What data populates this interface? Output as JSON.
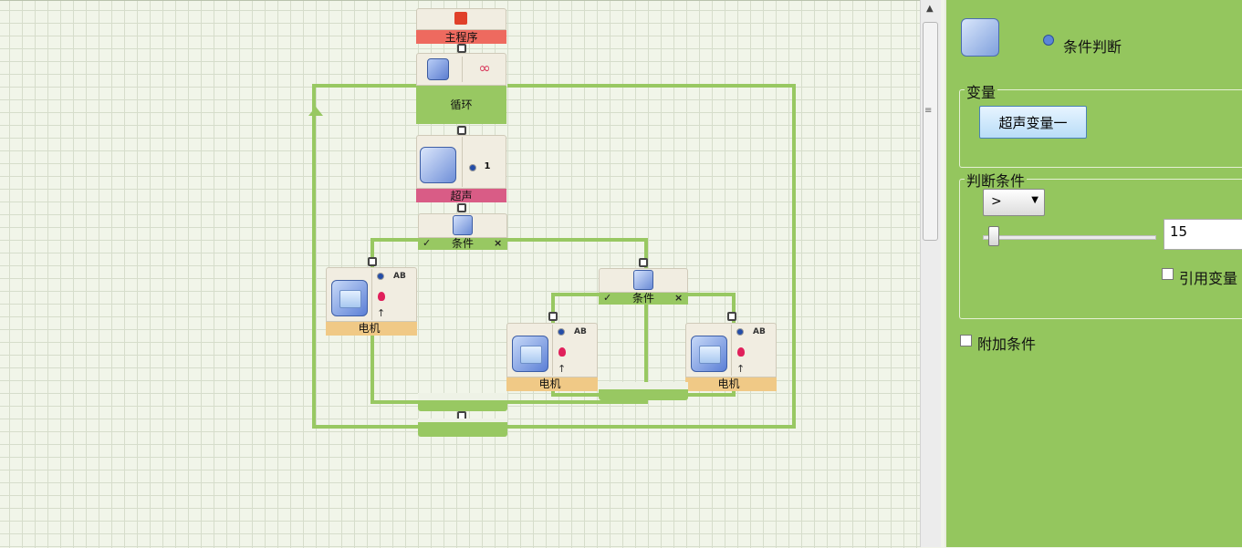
{
  "flow": {
    "main_program": "主程序",
    "loop": "循环",
    "loop_count_symbol": "∞",
    "ultrasonic": "超声",
    "ultrasonic_port": "1",
    "condition_1": "条件",
    "condition_2": "条件",
    "check_mark": "✓",
    "cross_mark": "×",
    "motor_1": "电机",
    "motor_2": "电机",
    "motor_3": "电机",
    "motor_ab": "AB"
  },
  "panel": {
    "title": "条件判断",
    "variable_group": "变量",
    "variable_button": "超声变量一",
    "condition_group": "判断条件",
    "operator": ">",
    "operator_options": [
      ">"
    ],
    "threshold_value": "15",
    "threshold_level": 0.05,
    "use_variable_label": "引用变量",
    "use_variable_checked": false,
    "extra_condition_label": "附加条件",
    "extra_condition_checked": false
  },
  "colors": {
    "wire": "#98c862",
    "main_bar": "#ee6a5f",
    "loop_bar": "#98c862",
    "ultrasonic_bar": "#d95c86",
    "motor_bar": "#f0c986",
    "panel_bg": "#94c65e"
  },
  "icons": [
    "chip-icon",
    "loop-icon",
    "infinity-icon",
    "speaker-icon",
    "branch-icon",
    "motor-icon",
    "light-bulb-icon",
    "arrow-up-icon",
    "port-dot-icon"
  ]
}
